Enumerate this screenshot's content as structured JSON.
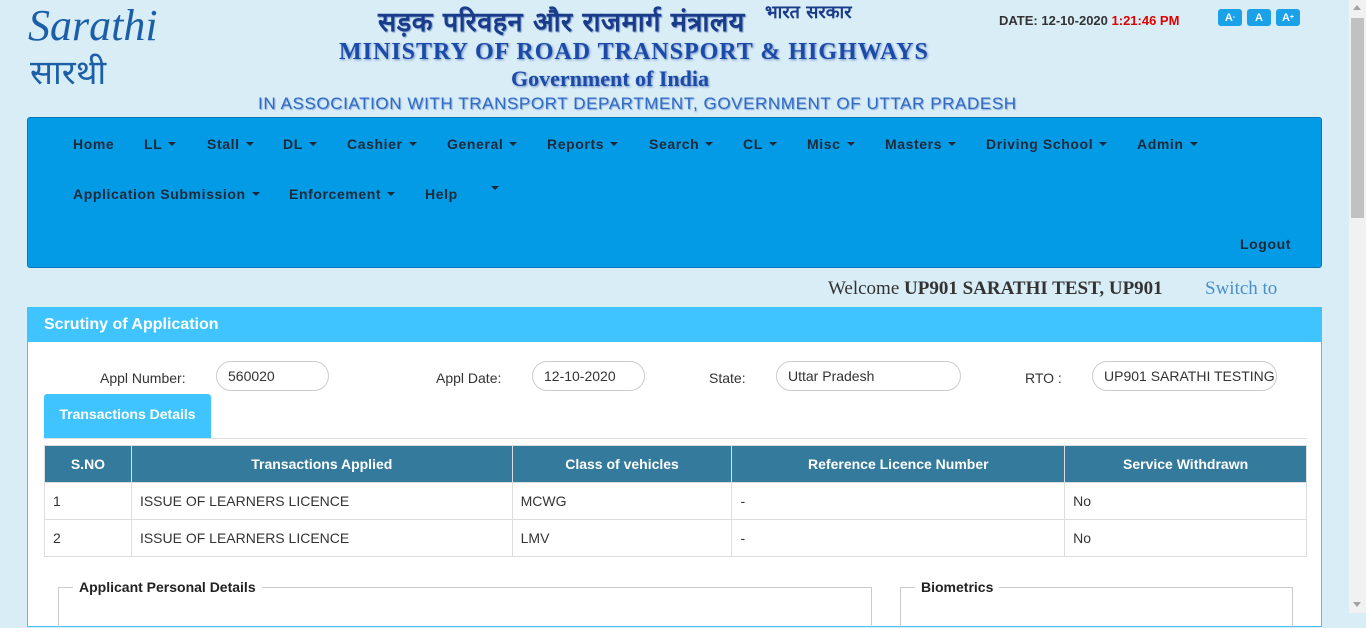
{
  "header": {
    "logo_text_en": "Sarathi",
    "logo_text_hi": "सारथी",
    "hindi_title": "सड़क परिवहन और राजमार्ग मंत्रालय",
    "hindi_govt": "भारत सरकार",
    "ministry": "MINISTRY OF ROAD TRANSPORT & HIGHWAYS",
    "government": "Government of India",
    "association": "IN ASSOCIATION WITH TRANSPORT DEPARTMENT, GOVERNMENT OF UTTAR PRADESH",
    "date_label": "DATE:",
    "date_value": "12-10-2020",
    "time_value": "1:21:46 PM",
    "font_buttons": [
      "A-",
      "A",
      "A+"
    ]
  },
  "nav": {
    "items": [
      {
        "label": "Home",
        "dropdown": false
      },
      {
        "label": "LL",
        "dropdown": true
      },
      {
        "label": "Stall",
        "dropdown": true
      },
      {
        "label": "DL",
        "dropdown": true
      },
      {
        "label": "Cashier",
        "dropdown": true
      },
      {
        "label": "General",
        "dropdown": true
      },
      {
        "label": "Reports",
        "dropdown": true
      },
      {
        "label": "Search",
        "dropdown": true
      },
      {
        "label": "CL",
        "dropdown": true
      },
      {
        "label": "Misc",
        "dropdown": true
      },
      {
        "label": "Masters",
        "dropdown": true
      },
      {
        "label": "Driving School",
        "dropdown": true
      },
      {
        "label": "Admin",
        "dropdown": true
      },
      {
        "label": "Application Submission",
        "dropdown": true
      },
      {
        "label": "Enforcement",
        "dropdown": true
      },
      {
        "label": "Help",
        "dropdown": false
      }
    ],
    "logout": "Logout"
  },
  "welcome": {
    "prefix": "Welcome",
    "user": "UP901 SARATHI TEST, UP901",
    "switch": "Switch to"
  },
  "panel": {
    "title": "Scrutiny of Application",
    "appl_number_label": "Appl Number:",
    "appl_number": "560020",
    "appl_date_label": "Appl Date:",
    "appl_date": "12-10-2020",
    "state_label": "State:",
    "state": "Uttar Pradesh",
    "rto_label": "RTO :",
    "rto": "UP901 SARATHI TESTING",
    "tab": "Transactions Details",
    "table": {
      "headers": [
        "S.NO",
        "Transactions Applied",
        "Class of vehicles",
        "Reference Licence Number",
        "Service Withdrawn"
      ],
      "rows": [
        [
          "1",
          "ISSUE OF LEARNERS LICENCE",
          "MCWG",
          "-",
          "No"
        ],
        [
          "2",
          "ISSUE OF LEARNERS LICENCE",
          "LMV",
          "-",
          "No"
        ]
      ]
    },
    "personal_legend": "Applicant Personal Details",
    "biometrics_legend": "Biometrics"
  },
  "colors": {
    "page_bg": "#d9edf7",
    "navbar": "#039be5",
    "panel_accent": "#40c4ff",
    "table_header": "#337a9c",
    "time": "#e00000"
  }
}
